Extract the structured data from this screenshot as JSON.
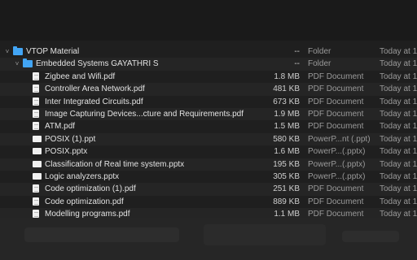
{
  "rows": [
    {
      "name": "VTOP Material",
      "size": "--",
      "kind": "Folder",
      "date": "Today at 1",
      "icon": "folder-icon",
      "indent": 0,
      "disclosure": true
    },
    {
      "name": "Embedded Systems GAYATHRI S",
      "size": "--",
      "kind": "Folder",
      "date": "Today at 1",
      "icon": "folder-icon",
      "indent": 1,
      "disclosure": true
    },
    {
      "name": "Zigbee and Wifi.pdf",
      "size": "1.8 MB",
      "kind": "PDF Document",
      "date": "Today at 1",
      "icon": "pdf-file-icon",
      "indent": 2
    },
    {
      "name": "Controller Area Network.pdf",
      "size": "481 KB",
      "kind": "PDF Document",
      "date": "Today at 1",
      "icon": "pdf-file-icon",
      "indent": 2
    },
    {
      "name": "Inter Integrated Circuits.pdf",
      "size": "673 KB",
      "kind": "PDF Document",
      "date": "Today at 1",
      "icon": "pdf-file-icon",
      "indent": 2
    },
    {
      "name": "Image Capturing Devices...cture and Requirements.pdf",
      "size": "1.9 MB",
      "kind": "PDF Document",
      "date": "Today at 1",
      "icon": "pdf-file-icon",
      "indent": 2
    },
    {
      "name": "ATM.pdf",
      "size": "1.5 MB",
      "kind": "PDF Document",
      "date": "Today at 1",
      "icon": "pdf-file-icon",
      "indent": 2
    },
    {
      "name": "POSIX (1).ppt",
      "size": "580 KB",
      "kind": "PowerP...nt (.ppt)",
      "date": "Today at 1",
      "icon": "ppt-file-icon",
      "indent": 2
    },
    {
      "name": "POSIX.pptx",
      "size": "1.6 MB",
      "kind": "PowerP...(.pptx)",
      "date": "Today at 1",
      "icon": "ppt-file-icon",
      "indent": 2
    },
    {
      "name": "Classification of Real time system.pptx",
      "size": "195 KB",
      "kind": "PowerP...(.pptx)",
      "date": "Today at 1",
      "icon": "ppt-file-icon",
      "indent": 2
    },
    {
      "name": "Logic analyzers.pptx",
      "size": "305 KB",
      "kind": "PowerP...(.pptx)",
      "date": "Today at 1",
      "icon": "ppt-file-icon",
      "indent": 2
    },
    {
      "name": "Code optimization (1).pdf",
      "size": "251 KB",
      "kind": "PDF Document",
      "date": "Today at 1",
      "icon": "pdf-file-icon",
      "indent": 2
    },
    {
      "name": "Code optimization.pdf",
      "size": "889 KB",
      "kind": "PDF Document",
      "date": "Today at 1",
      "icon": "pdf-file-icon",
      "indent": 2
    },
    {
      "name": "Modelling programs.pdf",
      "size": "1.1 MB",
      "kind": "PDF Document",
      "date": "Today at 1",
      "icon": "pdf-file-icon",
      "indent": 2
    }
  ]
}
